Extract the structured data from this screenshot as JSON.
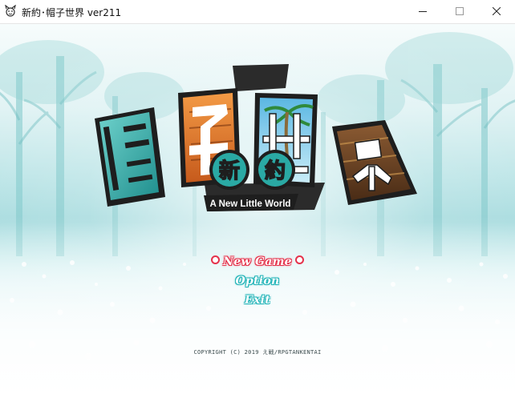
{
  "window": {
    "title": "新約･帽子世界 ver211",
    "icon": "hat-creature-icon",
    "controls": [
      "minimize-icon",
      "maximize-icon",
      "close-icon"
    ]
  },
  "logo": {
    "main_title": "帽子世界",
    "badge_chars": [
      "新",
      "約"
    ],
    "subtitle": "A New Little World"
  },
  "menu": {
    "new_game": "New Game",
    "option": "Option",
    "exit": "Exit",
    "selected": "new_game"
  },
  "copyright": "COPYRIGHT (C) 2019 え戦/RPGTANKENTAI",
  "colors": {
    "selected_outline": "#e5324b",
    "menu_outline": "#1fb3b7",
    "logo_teal": "#2aa9a4",
    "logo_orange": "#e0742a",
    "logo_dark": "#2b2b2b"
  }
}
